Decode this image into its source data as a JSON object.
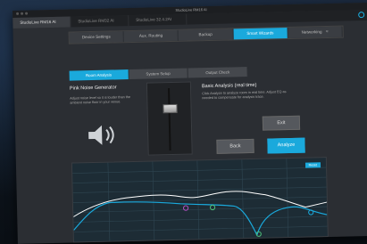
{
  "window": {
    "title": "StudioLive RM16 AI"
  },
  "device_tabs": [
    {
      "label": "StudioLive RM16 AI",
      "active": true
    },
    {
      "label": "StudioLive RM32 AI",
      "active": false
    },
    {
      "label": "StudioLive 32.4.2AI",
      "active": false
    }
  ],
  "main_tabs": [
    {
      "label": "Device Settings",
      "active": false
    },
    {
      "label": "Aux. Routing",
      "active": false
    },
    {
      "label": "Backup",
      "active": false
    },
    {
      "label": "Smart Wizards",
      "active": true
    },
    {
      "label": "Networking",
      "active": false
    }
  ],
  "sub_tabs": [
    {
      "label": "Room Analysis",
      "active": true
    },
    {
      "label": "System Setup",
      "active": false
    },
    {
      "label": "Output Check",
      "active": false
    }
  ],
  "pink": {
    "title": "Pink Noise Generator",
    "desc": "Adjust noise level so it is louder than the ambient noise floor in your venue."
  },
  "basic": {
    "title": "Basic Analysis (real time)",
    "desc": "Click Analyze to analyze room in real time. Adjust EQ as needed to compensate for analysis trace."
  },
  "buttons": {
    "exit": "Exit",
    "back": "Back",
    "analyze": "Analyze",
    "reset": "Reset"
  },
  "accent": "#1aa9dc",
  "icons": {
    "settings": "settings-circle-icon",
    "speaker": "speaker-icon",
    "wifi": "wifi-icon"
  }
}
